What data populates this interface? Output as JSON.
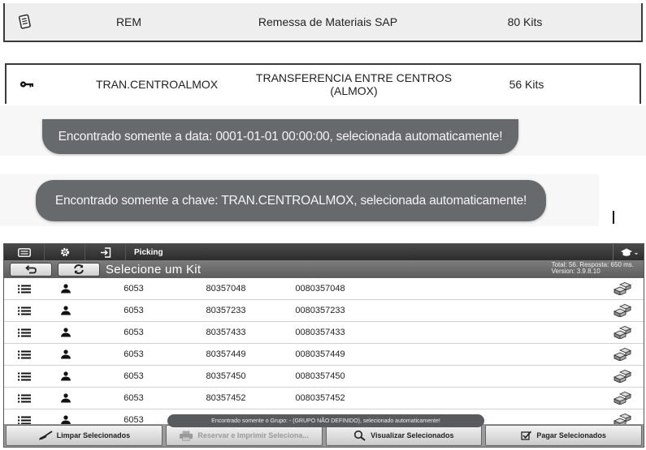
{
  "menu_rows": [
    {
      "code": "REM",
      "description": "Remessa de Materiais SAP",
      "quantity": "80 Kits",
      "icon": "document-icon"
    },
    {
      "code": "TRAN.CENTROALMOX",
      "description_line1": "TRANSFERENCIA ENTRE CENTROS",
      "description_line2": "(ALMOX)",
      "quantity": "56 Kits",
      "icon": "key-icon"
    }
  ],
  "toasts": {
    "date": "Encontrado somente a data: 0001-01-01 00:00:00, selecionada automaticamente!",
    "key": "Encontrado somente a chave: TRAN.CENTROALMOX, selecionada automaticamente!"
  },
  "app": {
    "topbar": {
      "title": "Picking",
      "icons": [
        "menu-icon",
        "settings-icon",
        "login-icon",
        "cap-icon"
      ]
    },
    "subbar": {
      "title": "Selecione um Kit",
      "info_line1": "Total: 56. Resposta: 650 ms.",
      "info_line2": "Version: 3.9.8.10"
    },
    "columns_note": "",
    "rows": [
      {
        "num": "6053",
        "code": "80357048",
        "full": "0080357048"
      },
      {
        "num": "6053",
        "code": "80357233",
        "full": "0080357233"
      },
      {
        "num": "6053",
        "code": "80357433",
        "full": "0080357433"
      },
      {
        "num": "6053",
        "code": "80357449",
        "full": "0080357449"
      },
      {
        "num": "6053",
        "code": "80357450",
        "full": "0080357450"
      },
      {
        "num": "6053",
        "code": "80357452",
        "full": "0080357452"
      },
      {
        "num": "6053",
        "code": "",
        "full": ""
      }
    ],
    "group_toast": "Encontrado somente o Grupo: - (GRUPO NÃO DEFINIDO), selecionado automaticamente!",
    "buttons": {
      "clear": "Limpar Selecionados",
      "reserve": "Reservar e Imprimir Seleciona...",
      "view": "Visualizar Selecionados",
      "pay": "Pagar Selecionados"
    }
  },
  "colors": {
    "toast_bg": "#666a6d",
    "topbar_bg": "#2c2c2c",
    "subbar_bg": "#6a6a6a"
  }
}
